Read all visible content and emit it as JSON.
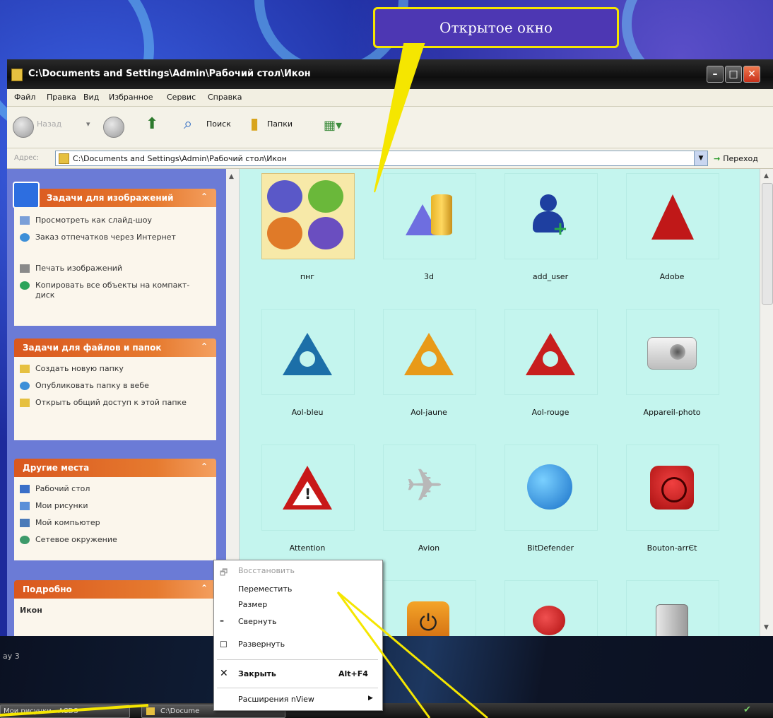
{
  "callout": {
    "text": "Открытое окно"
  },
  "window": {
    "title": "C:\\Documents and Settings\\Admin\\Рабочий стол\\Икон",
    "menu": [
      "Файл",
      "Правка",
      "Вид",
      "Избранное",
      "Сервис",
      "Справка"
    ],
    "toolbar": {
      "back": "Назад",
      "search": "Поиск",
      "folders": "Папки"
    },
    "address": {
      "label": "Адрес:",
      "value": "C:\\Documents and Settings\\Admin\\Рабочий стол\\Икон",
      "go": "Переход"
    }
  },
  "tasks": {
    "images": {
      "title": "Задачи для изображений",
      "items": [
        "Просмотреть как слайд-шоу",
        "Заказ отпечатков через Интернет",
        "Печать изображений",
        "Копировать все объекты на компакт-диск"
      ]
    },
    "files": {
      "title": "Задачи для файлов и папок",
      "items": [
        "Создать новую папку",
        "Опубликовать папку в вебе",
        "Открыть общий доступ к этой папке"
      ]
    },
    "places": {
      "title": "Другие места",
      "items": [
        "Рабочий стол",
        "Мои рисунки",
        "Мой компьютер",
        "Сетевое окружение"
      ]
    },
    "details": {
      "title": "Подробно",
      "name": "Икон"
    }
  },
  "files": [
    {
      "label": "пнг",
      "icon": "folder-png-icon"
    },
    {
      "label": "3d",
      "icon": "3d-shapes-icon"
    },
    {
      "label": "add_user",
      "icon": "add-user-icon"
    },
    {
      "label": "Adobe",
      "icon": "adobe-icon"
    },
    {
      "label": "Aol-bleu",
      "icon": "aol-blue-icon"
    },
    {
      "label": "Aol-jaune",
      "icon": "aol-yellow-icon"
    },
    {
      "label": "Aol-rouge",
      "icon": "aol-red-icon"
    },
    {
      "label": "Appareil-photo",
      "icon": "camera-icon"
    },
    {
      "label": "Attention",
      "icon": "warning-icon"
    },
    {
      "label": "Avion",
      "icon": "airplane-icon"
    },
    {
      "label": "BitDefender",
      "icon": "bitdefender-icon"
    },
    {
      "label": "Bouton-arrЄt",
      "icon": "stop-button-icon"
    },
    {
      "label": "",
      "icon": "power-icon"
    },
    {
      "label": "",
      "icon": "ladybug-icon"
    },
    {
      "label": "",
      "icon": "camcorder-icon"
    }
  ],
  "context_menu": {
    "restore": "Восстановить",
    "move": "Переместить",
    "size": "Размер",
    "minimize": "Свернуть",
    "maximize": "Развернуть",
    "close": "Закрыть",
    "close_shortcut": "Alt+F4",
    "extensions": "Расширения nView"
  },
  "desktop_label": "ay 3",
  "taskbar": {
    "item1": "Мои рисунки - ACDS",
    "item2": "C:\\Docume"
  }
}
